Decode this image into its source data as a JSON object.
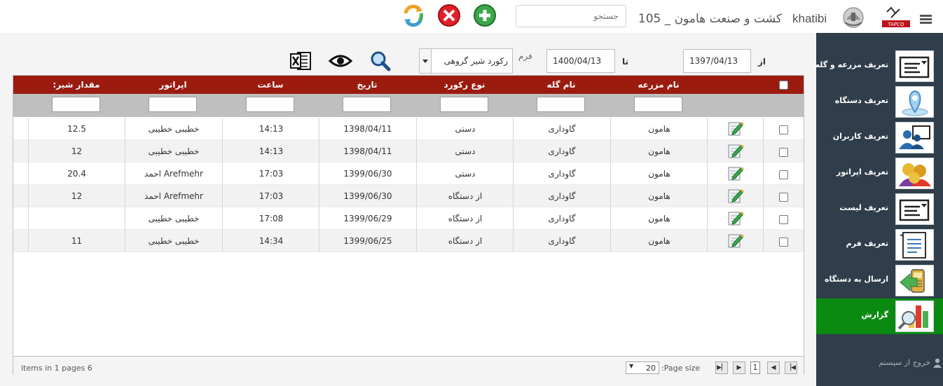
{
  "header": {
    "company_title": "کشت و صنعت هامون _ 105",
    "username": "khatibi",
    "search_placeholder": "جستجو",
    "logo_text": "TAPCO"
  },
  "sidebar": {
    "items": [
      {
        "label": "تعریف مزرعه و گله",
        "icon": "list-window-icon"
      },
      {
        "label": "تعریف دستگاه",
        "icon": "map-pin-icon"
      },
      {
        "label": "تعریف کاربران",
        "icon": "users-computer-icon"
      },
      {
        "label": "تعریف اپراتور",
        "icon": "operators-icon"
      },
      {
        "label": "تعریف لیست",
        "icon": "list-window-icon"
      },
      {
        "label": "تعریف فرم",
        "icon": "form-document-icon"
      },
      {
        "label": "ارسال به دستگاه",
        "icon": "send-device-icon"
      },
      {
        "label": "گزارش",
        "icon": "report-chart-icon",
        "active": true
      }
    ],
    "logout_label": "خروج از سیستم"
  },
  "filters": {
    "from_label": "از",
    "from_value": "1397/04/13",
    "to_label": "تا",
    "to_value": "1400/04/13",
    "form_label": "فرم",
    "form_value": "رکورد شیر گروهی"
  },
  "grid": {
    "columns": [
      "نام مزرعه",
      "نام گله",
      "نوع رکورد",
      "تاریخ",
      "ساعت",
      "اپراتور",
      "مقدار شیر:"
    ],
    "rows": [
      [
        "هامون",
        "گاوداری",
        "دستی",
        "1398/04/11",
        "14:13",
        "خطیبی خطیبی",
        "12.5"
      ],
      [
        "هامون",
        "گاوداری",
        "دستی",
        "1398/04/11",
        "14:13",
        "خطیبی خطیبی",
        "12"
      ],
      [
        "هامون",
        "گاوداری",
        "دستی",
        "1399/06/30",
        "17:03",
        "Arefmehr احمد",
        "20.4"
      ],
      [
        "هامون",
        "گاوداری",
        "از دستگاه",
        "1399/06/30",
        "17:03",
        "Arefmehr احمد",
        "12"
      ],
      [
        "هامون",
        "گاوداری",
        "از دستگاه",
        "1399/06/29",
        "17:08",
        "خطیبی خطیبی",
        ""
      ],
      [
        "هامون",
        "گاوداری",
        "از دستگاه",
        "1399/06/25",
        "14:34",
        "خطیبی خطیبی",
        "11"
      ]
    ]
  },
  "pager": {
    "current_page": "1",
    "page_size": "20",
    "page_size_label": "Page size:",
    "summary": "items in 1 pages 6"
  },
  "colors": {
    "header_bg": "#9b1b0f",
    "sidebar_bg": "#2f3e4a",
    "active_item": "#0b8a12"
  }
}
